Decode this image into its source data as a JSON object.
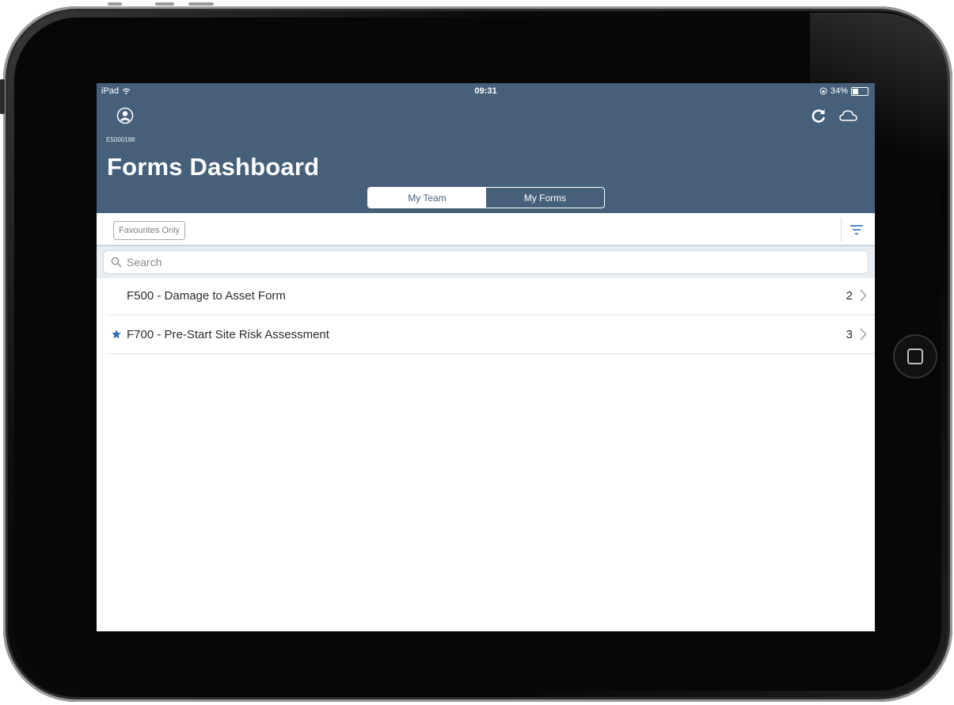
{
  "device": {
    "status_bar": {
      "carrier": "iPad",
      "time": "09:31",
      "battery": "34%",
      "battery_level": 0.34
    }
  },
  "header": {
    "user_id": "E5000188",
    "title": "Forms Dashboard",
    "tabs": [
      {
        "label": "My Team",
        "active": true
      },
      {
        "label": "My Forms",
        "active": false
      }
    ]
  },
  "toolbar": {
    "favourites_label": "Favourites Only"
  },
  "search": {
    "placeholder": "Search",
    "value": ""
  },
  "forms": [
    {
      "label": "F500 - Damage to Asset Form",
      "count": "2",
      "favourite": false
    },
    {
      "label": "F700 - Pre-Start Site Risk Assessment",
      "count": "3",
      "favourite": true
    }
  ],
  "colors": {
    "header": "#46607a",
    "accent": "#2d6fb6",
    "star": "#2d6fb6"
  },
  "icons": {
    "avatar": "avatar-icon",
    "refresh": "refresh-icon",
    "cloud": "cloud-icon",
    "filter": "filter-icon",
    "search": "search-icon",
    "star": "star-icon",
    "chevron": "chevron-right-icon"
  }
}
